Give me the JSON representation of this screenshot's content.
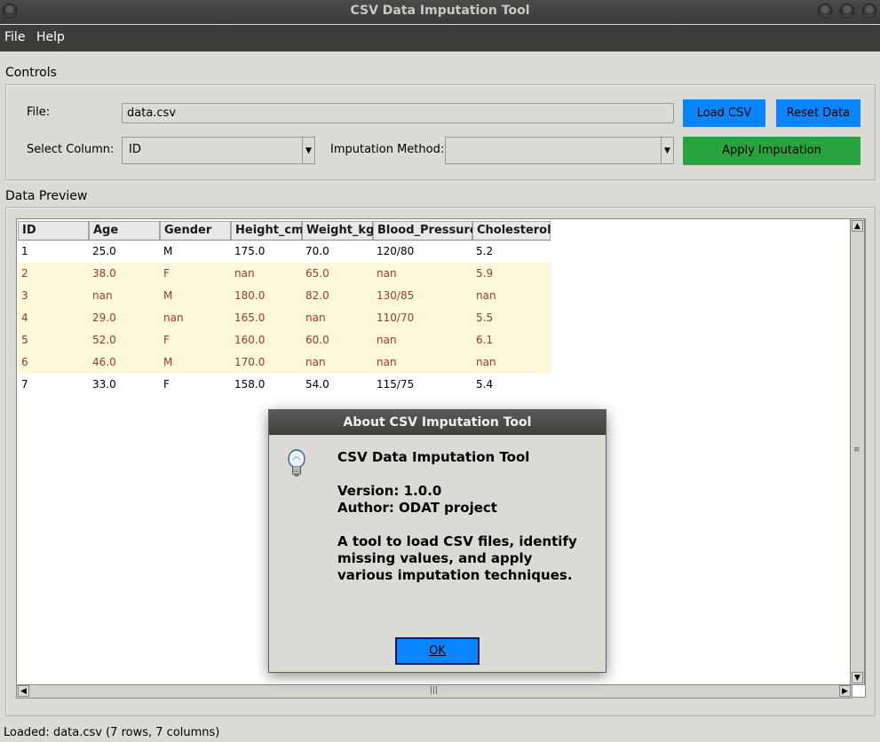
{
  "window": {
    "title": "CSV Data Imputation Tool"
  },
  "menu": {
    "file": "File",
    "help": "Help"
  },
  "controls": {
    "section_label": "Controls",
    "file_label": "File:",
    "file_value": "data.csv",
    "load_button": "Load CSV",
    "reset_button": "Reset Data",
    "select_column_label": "Select Column:",
    "select_column_value": "ID",
    "imputation_label": "Imputation Method:",
    "imputation_value": "",
    "apply_button": "Apply Imputation",
    "colors": {
      "blue_button": "#0a84ff",
      "green_button": "#29a33d"
    }
  },
  "preview": {
    "section_label": "Data Preview",
    "columns": [
      "ID",
      "Age",
      "Gender",
      "Height_cm",
      "Weight_kg",
      "Blood_Pressure",
      "Cholesterol"
    ],
    "rows": [
      {
        "missing": false,
        "cells": [
          "1",
          "25.0",
          "M",
          "175.0",
          "70.0",
          "120/80",
          "5.2"
        ]
      },
      {
        "missing": true,
        "cells": [
          "2",
          "38.0",
          "F",
          "nan",
          "65.0",
          "nan",
          "5.9"
        ]
      },
      {
        "missing": true,
        "cells": [
          "3",
          "nan",
          "M",
          "180.0",
          "82.0",
          "130/85",
          "nan"
        ]
      },
      {
        "missing": true,
        "cells": [
          "4",
          "29.0",
          "nan",
          "165.0",
          "nan",
          "110/70",
          "5.5"
        ]
      },
      {
        "missing": true,
        "cells": [
          "5",
          "52.0",
          "F",
          "160.0",
          "60.0",
          "nan",
          "6.1"
        ]
      },
      {
        "missing": true,
        "cells": [
          "6",
          "46.0",
          "M",
          "170.0",
          "nan",
          "nan",
          "nan"
        ]
      },
      {
        "missing": false,
        "cells": [
          "7",
          "33.0",
          "F",
          "158.0",
          "54.0",
          "115/75",
          "5.4"
        ]
      }
    ],
    "colors": {
      "missing_row_bg": "#fdf8d9",
      "missing_row_text": "#a0382e"
    }
  },
  "status": {
    "text": "Loaded: data.csv (7 rows, 7 columns)"
  },
  "dialog": {
    "title": "About CSV Imputation Tool",
    "icon": "lightbulb-icon",
    "heading": "CSV Data Imputation Tool",
    "version": "Version: 1.0.0",
    "author": "Author: ODAT project",
    "description": "A tool to load CSV files, identify\nmissing values, and apply\nvarious imputation techniques.",
    "ok_button": "OK"
  }
}
